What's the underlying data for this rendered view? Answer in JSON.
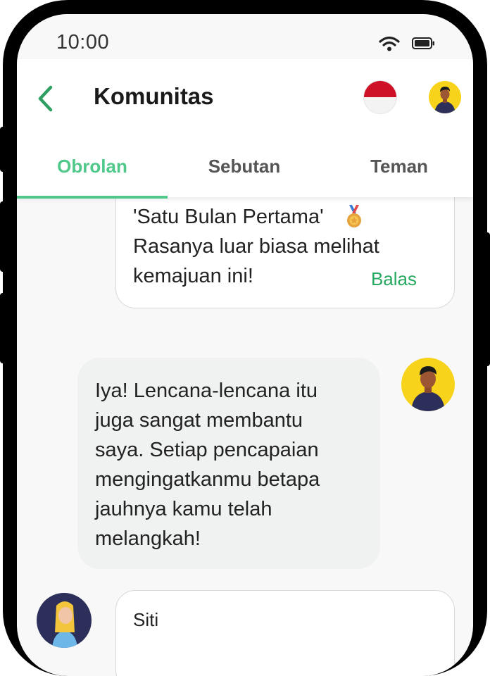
{
  "status_bar": {
    "time": "10:00",
    "wifi_icon": "wifi-icon",
    "battery_icon": "battery-icon"
  },
  "header": {
    "title": "Komunitas",
    "back_icon": "chevron-left-icon",
    "language_flag": "indonesia-flag-icon",
    "avatar": "user-avatar"
  },
  "tabs": [
    {
      "label": "Obrolan",
      "active": true
    },
    {
      "label": "Sebutan",
      "active": false
    },
    {
      "label": "Teman",
      "active": false
    }
  ],
  "messages": [
    {
      "text": "'Satu Bulan Pertama'\nRasanya luar biasa melihat\nkemajuan ini!",
      "badge_icon": "medal-icon",
      "reply_label": "Balas"
    },
    {
      "text": "Iya! Lencana-lencana itu\njuga sangat membantu\nsaya. Setiap pencapaian\nmengingatkanmu betapa\njauhnya kamu telah\nmelangkah!",
      "sender": "own"
    },
    {
      "author": "Siti"
    }
  ],
  "colors": {
    "accent": "#4fc88a",
    "reply": "#27a860",
    "bubble": "#f0f1f1",
    "avatar_bg": "#f8d31c"
  }
}
